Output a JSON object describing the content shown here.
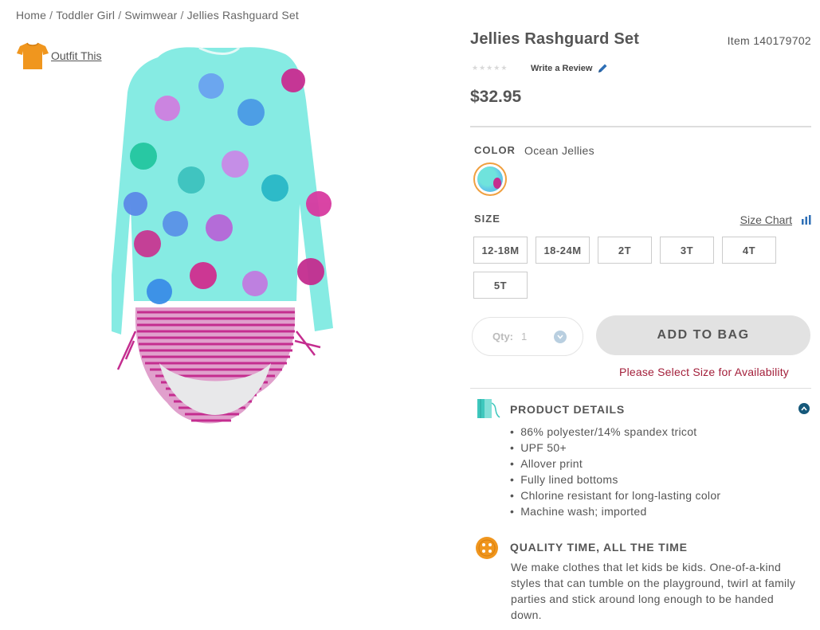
{
  "breadcrumb": {
    "items": [
      "Home",
      "Toddler Girl",
      "Swimwear",
      "Jellies Rashguard Set"
    ],
    "separator": "/"
  },
  "outfit": {
    "label": "Outfit This",
    "icon": "tshirt-icon",
    "icon_color": "#f0961e"
  },
  "product": {
    "title": "Jellies Rashguard Set",
    "item_number": "Item 140179702",
    "rating": 0,
    "rating_max": 5,
    "write_review": "Write a Review",
    "price": "$32.95"
  },
  "color": {
    "label": "COLOR",
    "value": "Ocean Jellies",
    "swatch_accent": "#f0a040"
  },
  "size": {
    "label": "SIZE",
    "chart_link": "Size Chart",
    "options": [
      "12-18M",
      "18-24M",
      "2T",
      "3T",
      "4T",
      "5T"
    ]
  },
  "quantity": {
    "label": "Qty:",
    "value": "1"
  },
  "cart": {
    "add_label": "ADD TO BAG",
    "availability_msg": "Please Select Size for Availability",
    "availability_color": "#a31f3a"
  },
  "details": {
    "title": "PRODUCT DETAILS",
    "items": [
      "86% polyester/14% spandex tricot",
      "UPF 50+",
      "Allover print",
      "Fully lined bottoms",
      "Chlorine resistant for long-lasting color",
      "Machine wash; imported"
    ]
  },
  "quality": {
    "title": "QUALITY TIME, ALL THE TIME",
    "text": "We make clothes that let kids be kids. One-of-a-kind styles that can tumble on the playground, twirl at family parties and stick around long enough to be handed down."
  }
}
